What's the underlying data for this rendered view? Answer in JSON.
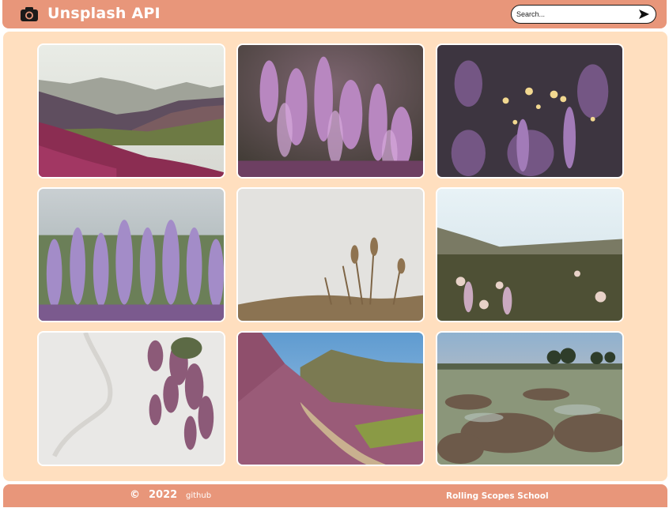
{
  "header": {
    "title": "Unsplash API",
    "logo_icon": "camera-icon",
    "search": {
      "placeholder": "Search...",
      "value": "",
      "submit_icon": "send-arrow-icon"
    }
  },
  "gallery": {
    "images": [
      {
        "subject": "mountain valley with heather"
      },
      {
        "subject": "purple heather flowers close-up"
      },
      {
        "subject": "heather with bokeh lights"
      },
      {
        "subject": "heather field under sky"
      },
      {
        "subject": "dry grass against pale sky"
      },
      {
        "subject": "heather meadow at sunrise"
      },
      {
        "subject": "heather sprig on white"
      },
      {
        "subject": "trail through heather hills"
      },
      {
        "subject": "frosty moorland"
      }
    ]
  },
  "footer": {
    "copyright_symbol": "©",
    "year": "2022",
    "github_label": "github",
    "school_label": "Rolling Scopes School"
  },
  "colors": {
    "header_bg": "#e8967a",
    "panel_bg": "#ffdfbf",
    "text_light": "#ffffff"
  }
}
